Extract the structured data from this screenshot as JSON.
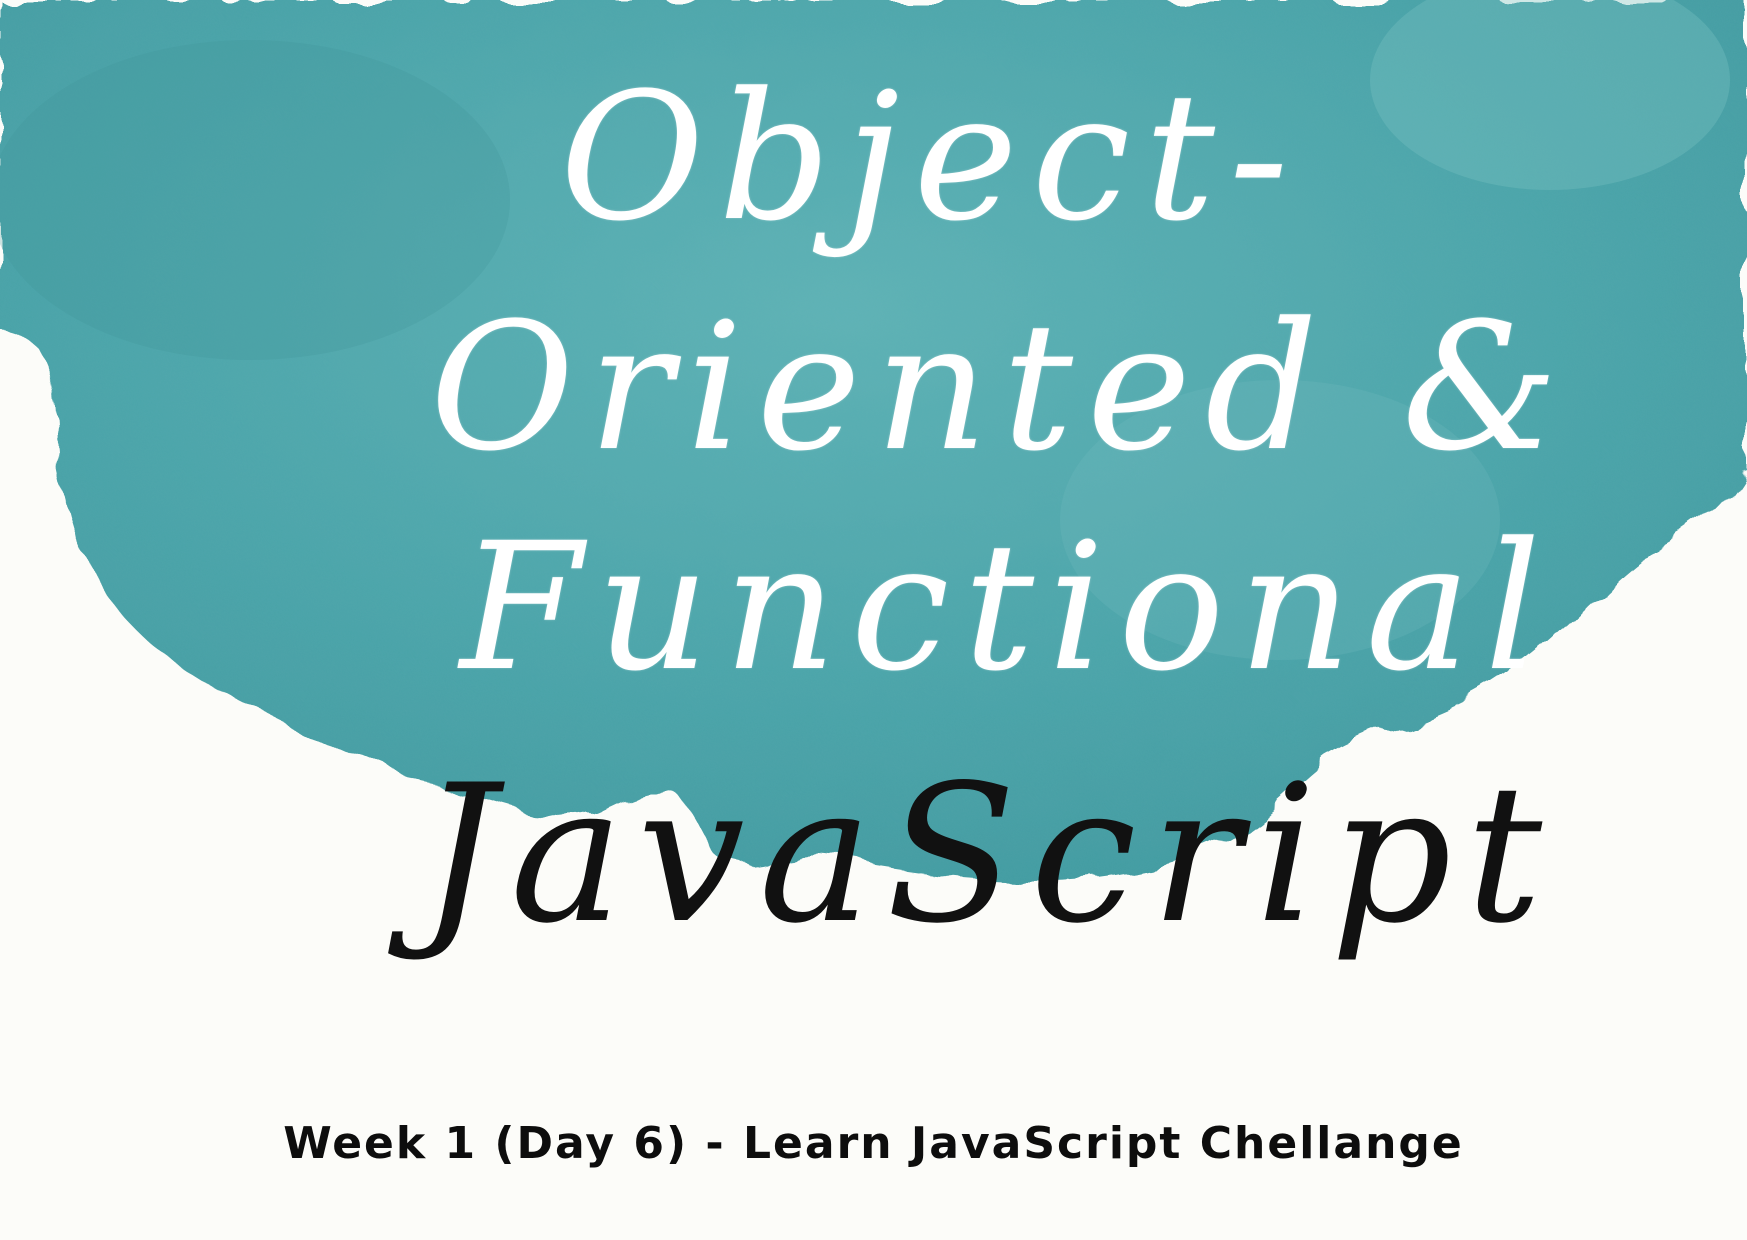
{
  "title": {
    "line1": "Object-",
    "line2": "Oriented  &",
    "line3": "Functional",
    "line4": "JavaScript"
  },
  "caption": "Week 1 (Day 6) - Learn JavaScript Chellange",
  "colors": {
    "background": "#fcfcf9",
    "watercolor": "#4aa3a8",
    "title_light": "#ffffff",
    "title_dark": "#111111"
  }
}
